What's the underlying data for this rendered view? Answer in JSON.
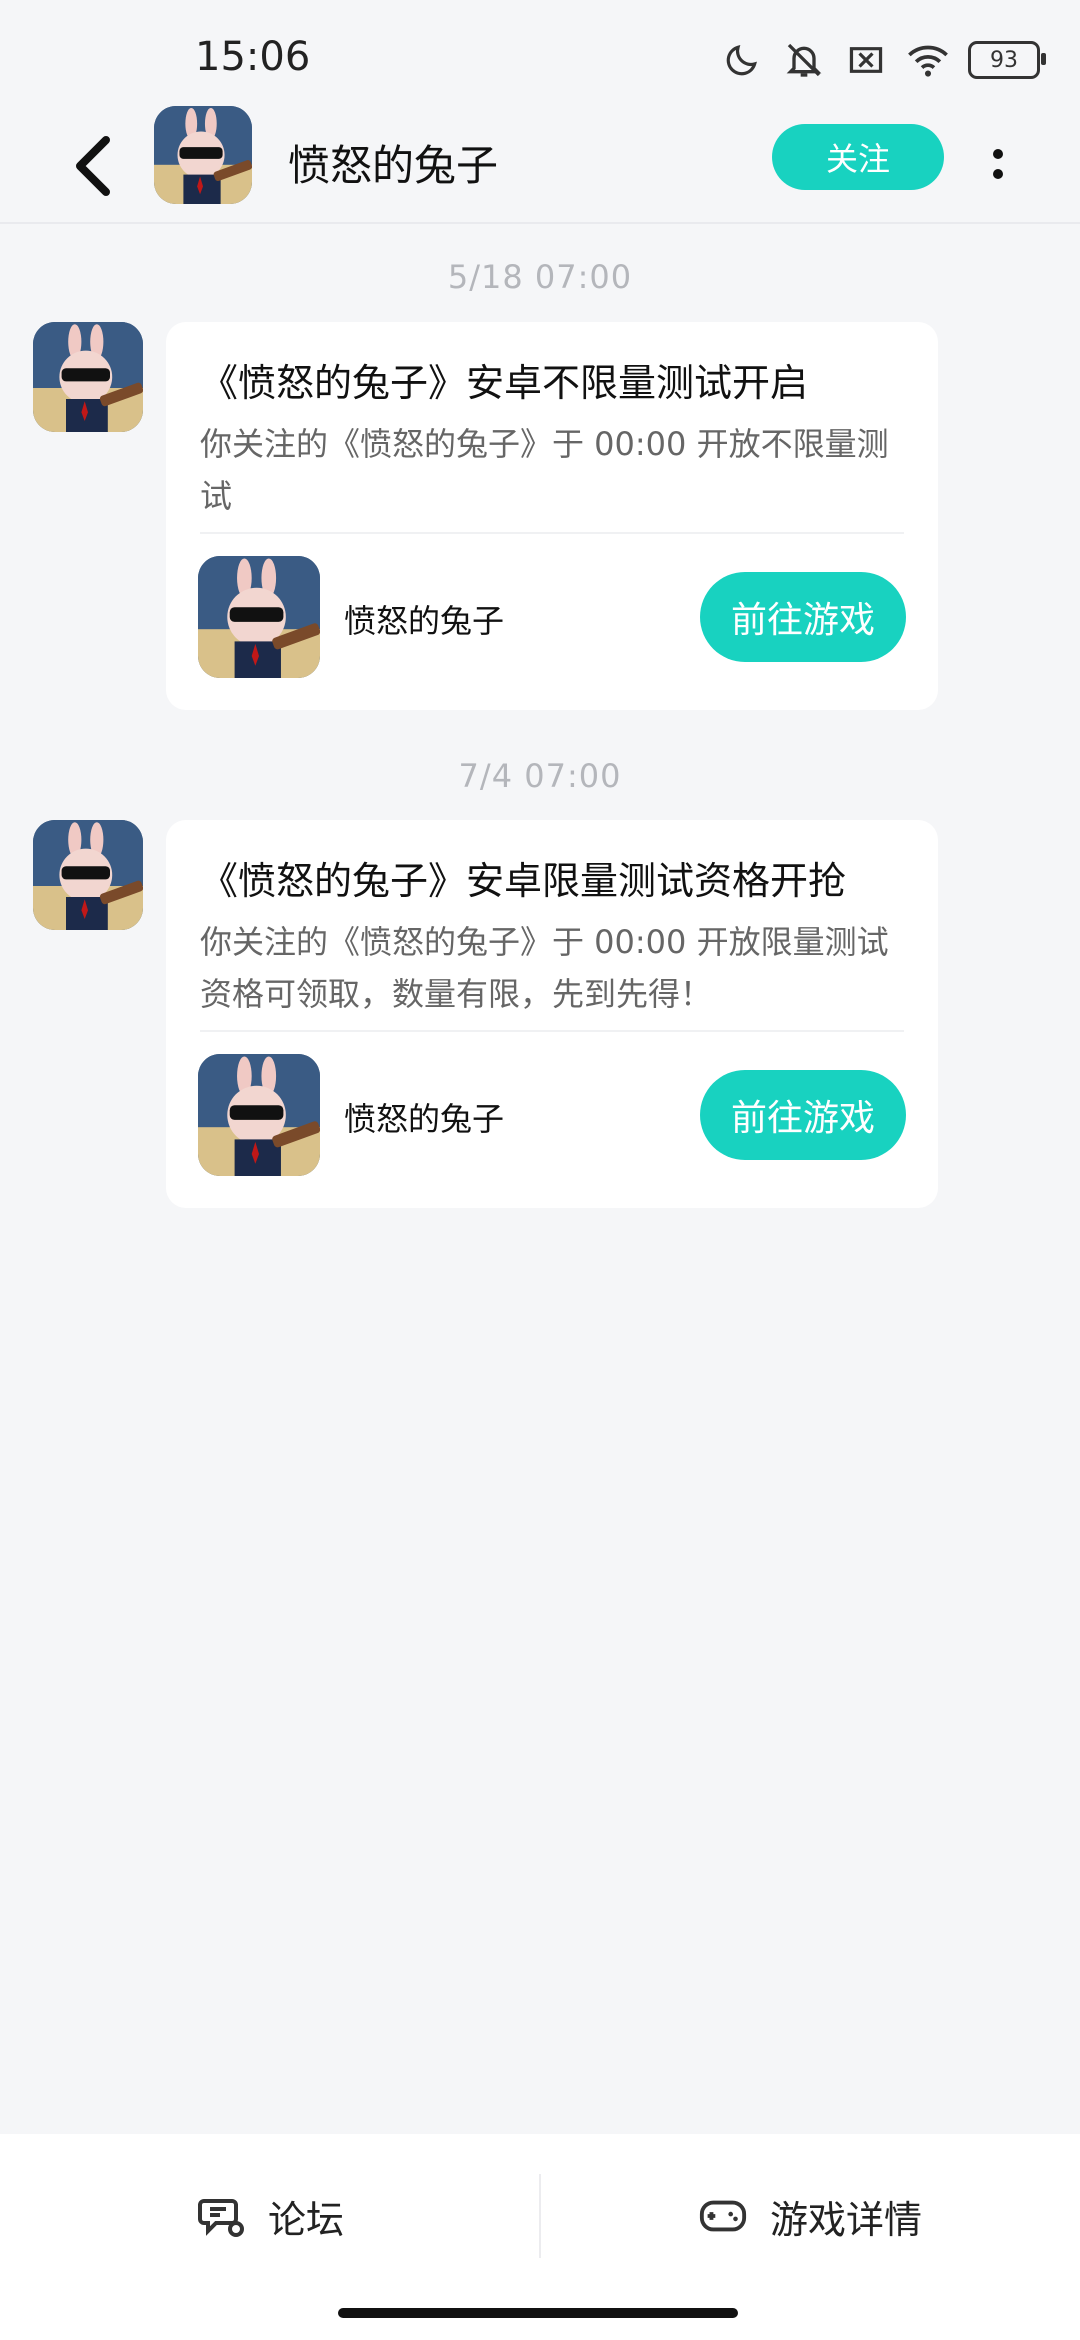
{
  "status_bar": {
    "time": "15:06",
    "battery": "93",
    "icons": [
      "moon-icon",
      "bell-off-icon",
      "sim-x-icon",
      "wifi-icon",
      "battery-icon"
    ]
  },
  "header": {
    "title": "愤怒的兔子",
    "follow_label": "关注"
  },
  "messages": [
    {
      "time": "5/18  07:00",
      "title": "《愤怒的兔子》安卓不限量测试开启",
      "desc": "你关注的《愤怒的兔子》于 00:00 开放不限量测试",
      "game_name": "愤怒的兔子",
      "button": "前往游戏"
    },
    {
      "time": "7/4  07:00",
      "title": "《愤怒的兔子》安卓限量测试资格开抢",
      "desc": "你关注的《愤怒的兔子》于 00:00 开放限量测试资格可领取，数量有限，先到先得！",
      "game_name": "愤怒的兔子",
      "button": "前往游戏"
    }
  ],
  "bottom_bar": {
    "forum_label": "论坛",
    "details_label": "游戏详情"
  },
  "colors": {
    "accent": "#18d2c0",
    "background": "#f5f6f8"
  }
}
